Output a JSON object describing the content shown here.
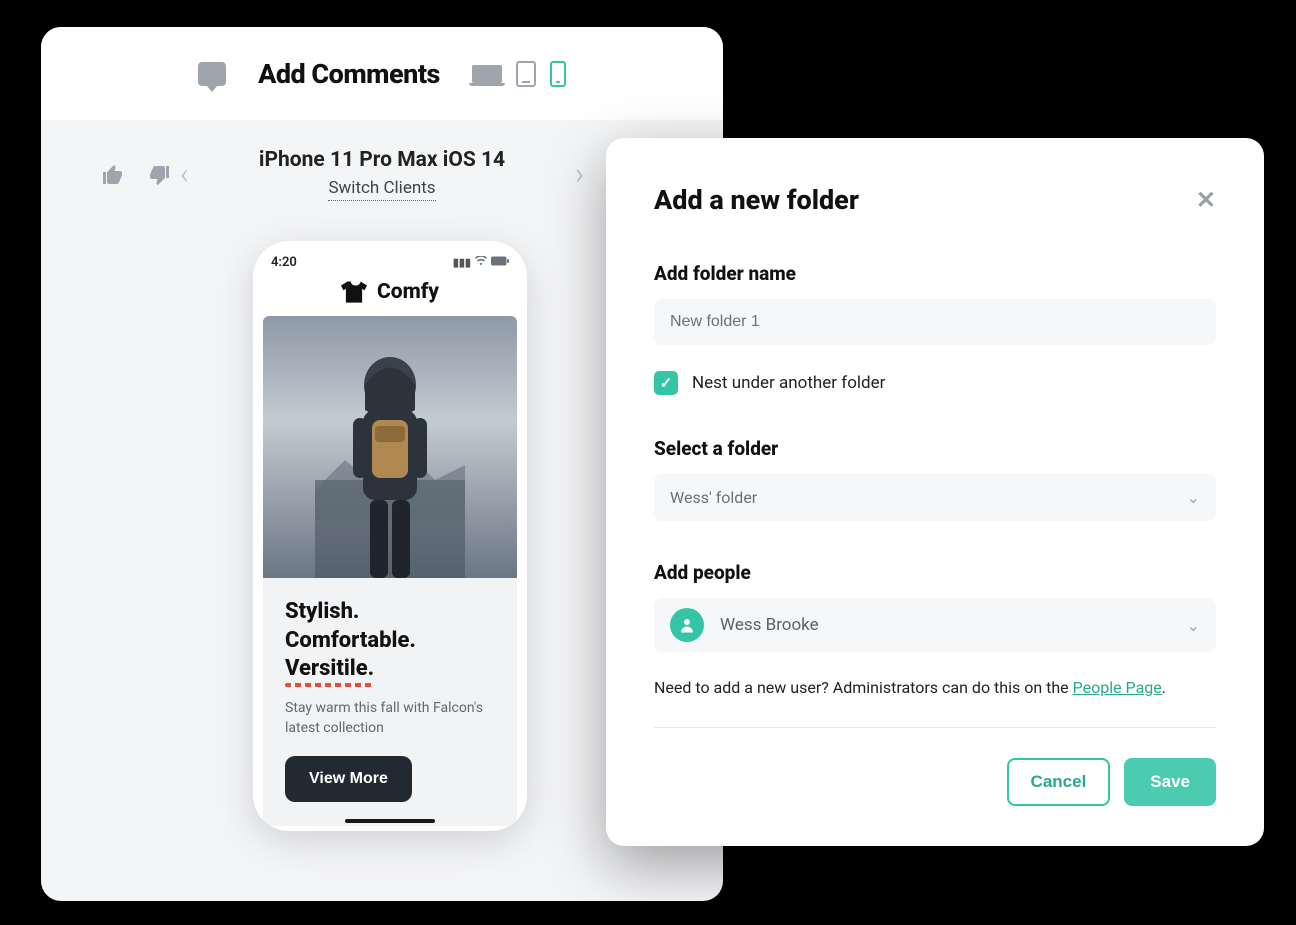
{
  "preview": {
    "topbar": {
      "title": "Add Comments"
    },
    "client": {
      "device_name": "iPhone 11 Pro Max iOS 14",
      "switch_label": "Switch Clients"
    },
    "phone": {
      "time": "4:20",
      "brand": "Comfy",
      "headline": {
        "line1": "Stylish.",
        "line2": "Comfortable.",
        "line3": "Versitile."
      },
      "subtext": "Stay warm this fall with Falcon's latest collection",
      "view_more_label": "View More"
    }
  },
  "modal": {
    "title": "Add a new folder",
    "folder_name_label": "Add folder name",
    "folder_name_value": "New folder 1",
    "nest_label": "Nest under another folder",
    "select_folder_label": "Select a folder",
    "selected_folder": "Wess' folder",
    "add_people_label": "Add people",
    "selected_person": "Wess Brooke",
    "helper": {
      "prefix": "Need to add a new user? Administrators can do this on the ",
      "link": "People Page",
      "suffix": "."
    },
    "cancel_label": "Cancel",
    "save_label": "Save"
  }
}
